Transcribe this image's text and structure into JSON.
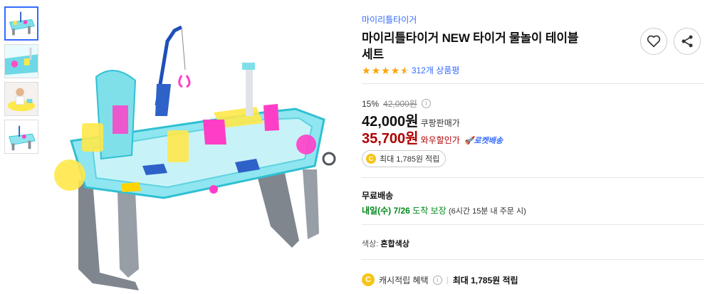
{
  "product": {
    "brand": "마이리틀타이거",
    "title_line1": "마이리틀타이거 NEW 타이거 물놀이 테이블",
    "title_line2": "세트",
    "rating": 4.5,
    "review_count": "312개 상품평"
  },
  "pricing": {
    "discount_rate": "15%",
    "original_price": "42,000원",
    "info_glyph": "i",
    "coupang_price": "42,000원",
    "coupang_label": "쿠팡판매가",
    "wow_price": "35,700원",
    "wow_label": "와우할인가",
    "rocket_label": "로켓배송",
    "reward_text": "최대 1,785원 적립",
    "coin_glyph": "C"
  },
  "shipping": {
    "title": "무료배송",
    "date": "내일(수) 7/26",
    "guarantee": "도착 보장",
    "condition": "(6시간 15분 내 주문 시)"
  },
  "option": {
    "label": "색상:",
    "value": "혼합색상"
  },
  "cash": {
    "label": "캐시적립 혜택",
    "sep": "|",
    "amount": "최대 1,785원 적립"
  },
  "icons": {
    "wishlist": "heart-icon",
    "share": "share-icon",
    "star": "star-icon",
    "info": "info-icon",
    "coin": "coin-icon",
    "rocket": "rocket-icon"
  },
  "colors": {
    "accent_blue": "#346aff",
    "wow_red": "#ae0000",
    "ship_green": "#00891a",
    "star": "#f9a402"
  }
}
